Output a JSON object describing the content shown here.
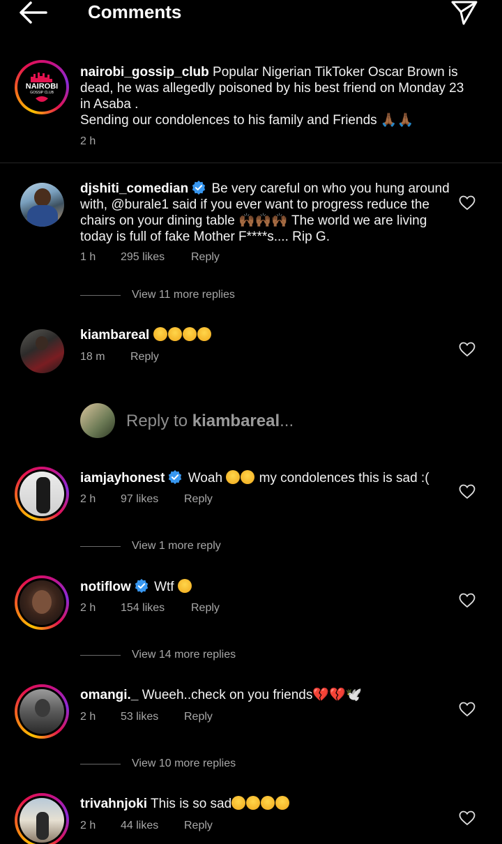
{
  "header": {
    "title": "Comments"
  },
  "caption": {
    "username": "nairobi_gossip_club",
    "logo_text": "NAIROBI",
    "logo_sub": "GOSSIP CLUB",
    "text": "Popular Nigerian TikToker Oscar Brown is dead, he was allegedly poisoned by his best friend on Monday 23 in Asaba .",
    "text2": "Sending our condolences to his family and Friends",
    "emoji": "🙏🏾🙏🏾",
    "time": "2 h"
  },
  "comments": [
    {
      "username": "djshiti_comedian",
      "verified": true,
      "text": "Be very careful on who you hung around with, @burale1 said if you ever want to progress reduce the chairs on your dining table 🙌🏾🙌🏾🙌🏾 The world we are living today is full of fake Mother F****s.... Rip G.",
      "time": "1 h",
      "likes": "295 likes",
      "reply": "Reply",
      "view_more": "View 11 more replies"
    },
    {
      "username": "kiambareal",
      "verified": false,
      "text": "",
      "time": "18 m",
      "likes": "",
      "reply": "Reply",
      "view_more": ""
    },
    {
      "username": "iamjayhonest",
      "verified": true,
      "text_before": "Woah",
      "text_after": "my condolences this is sad :(",
      "time": "2 h",
      "likes": "97 likes",
      "reply": "Reply",
      "view_more": "View 1 more reply"
    },
    {
      "username": "notiflow",
      "verified": true,
      "text": "Wtf",
      "time": "2 h",
      "likes": "154 likes",
      "reply": "Reply",
      "view_more": "View 14 more replies"
    },
    {
      "username": "omangi._",
      "verified": false,
      "text": "Wueeh..check on you friends💔💔🕊️",
      "time": "2 h",
      "likes": "53 likes",
      "reply": "Reply",
      "view_more": "View 10 more replies"
    },
    {
      "username": "trivahnjoki",
      "verified": false,
      "text": "This is so sad",
      "time": "2 h",
      "likes": "44 likes",
      "reply": "Reply",
      "view_more": ""
    }
  ],
  "reply_box": {
    "prefix": "Reply to ",
    "target": "kiambareal",
    "suffix": "..."
  },
  "colors": {
    "background": "#000000",
    "text": "#f5f5f5",
    "secondary": "#a8a8a8",
    "verified": "#3897f0"
  }
}
